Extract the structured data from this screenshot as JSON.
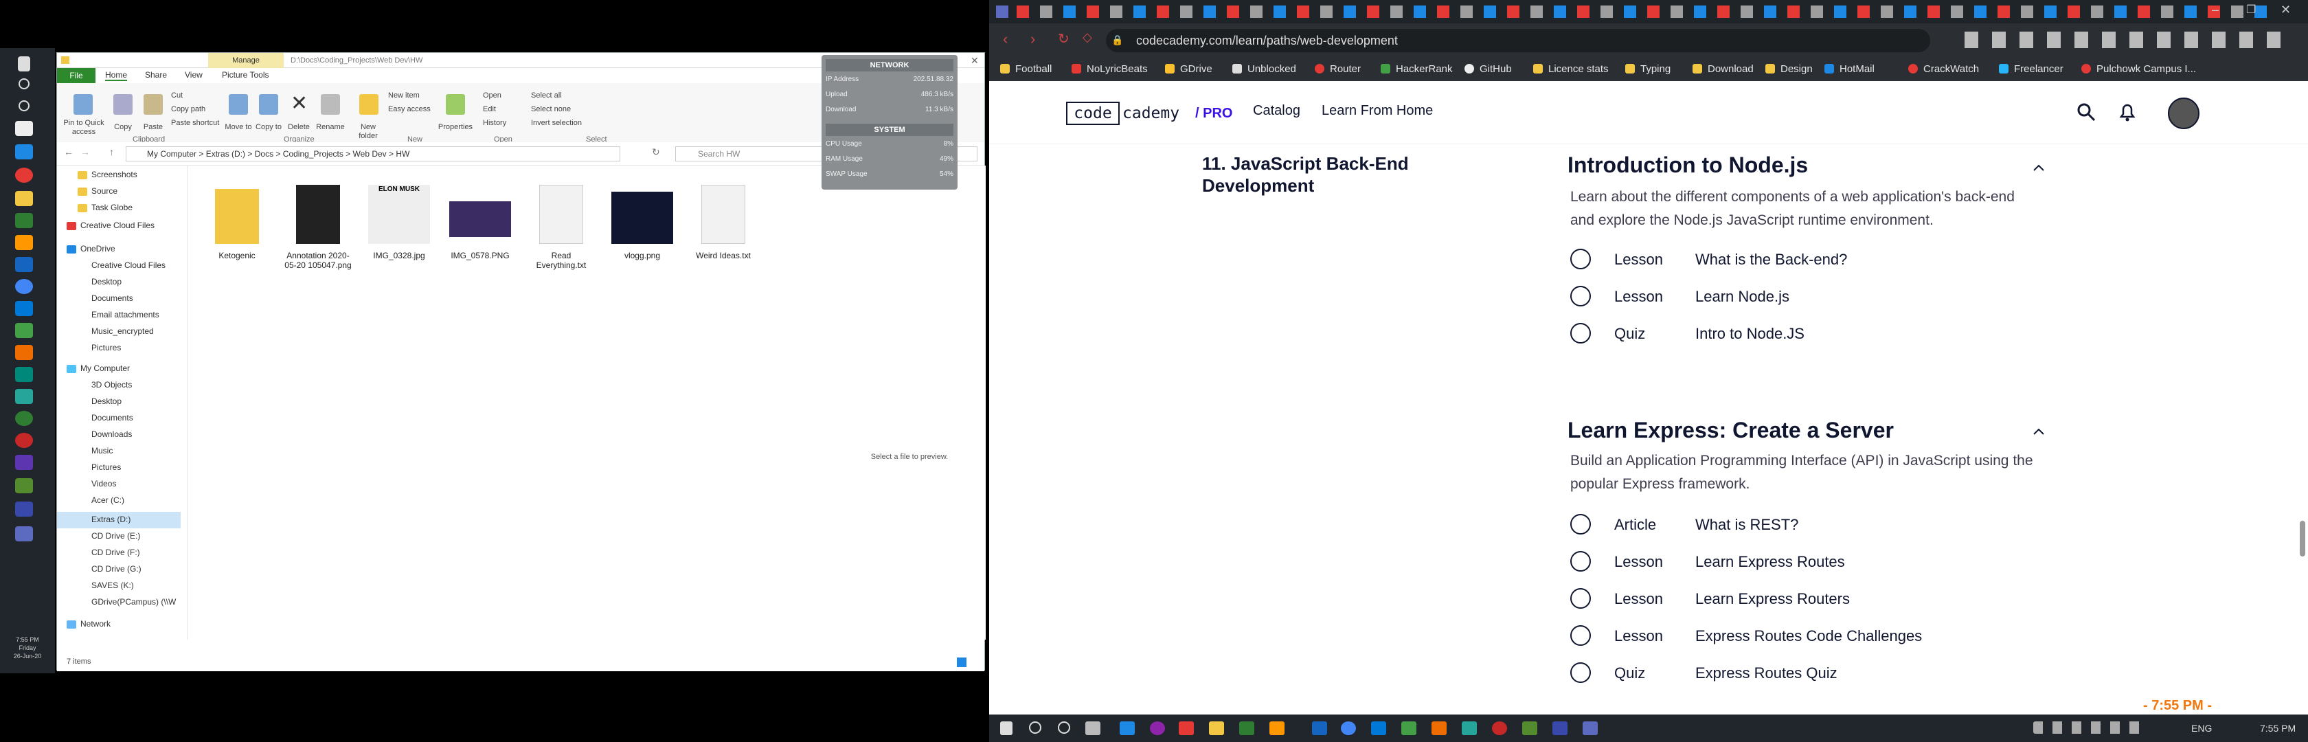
{
  "left_taskbar": {
    "time": "7:55 PM",
    "day": "Friday",
    "date": "26-Jun-20"
  },
  "explorer": {
    "manage_label": "Manage",
    "title_path": "D:\\Docs\\Coding_Projects\\Web Dev\\HW",
    "tabs": [
      "File",
      "Home",
      "Share",
      "View",
      "Picture Tools"
    ],
    "ribbon": {
      "pin": "Pin to Quick access",
      "copy": "Copy",
      "paste": "Paste",
      "cut": "Cut",
      "copy_path": "Copy path",
      "paste_shortcut": "Paste shortcut",
      "move_to": "Move to",
      "copy_to": "Copy to",
      "delete": "Delete",
      "rename": "Rename",
      "new_folder": "New folder",
      "new_item": "New item",
      "easy_access": "Easy access",
      "properties": "Properties",
      "open": "Open",
      "edit": "Edit",
      "history": "History",
      "select_all": "Select all",
      "select_none": "Select none",
      "invert": "Invert selection",
      "groups": [
        "Clipboard",
        "Organize",
        "New",
        "Open",
        "Select"
      ]
    },
    "address": [
      "My Computer",
      "Extras (D:)",
      "Docs",
      "Coding_Projects",
      "Web Dev",
      "HW"
    ],
    "search_placeholder": "Search HW",
    "nav": [
      "Screenshots",
      "Source",
      "Task Globe",
      "Creative Cloud Files",
      "OneDrive",
      "Creative Cloud Files",
      "Desktop",
      "Documents",
      "Email attachments",
      "Music_encrypted",
      "Pictures",
      "My Computer",
      "3D Objects",
      "Desktop",
      "Documents",
      "Downloads",
      "Music",
      "Pictures",
      "Videos",
      "Acer (C:)",
      "Extras (D:)",
      "CD Drive (E:)",
      "CD Drive (F:)",
      "CD Drive (G:)",
      "SAVES (K:)",
      "GDrive(PCampus) (\\\\W",
      "Network"
    ],
    "files": [
      "Ketogenic",
      "Annotation 2020-05-20 105047.png",
      "IMG_0328.jpg",
      "IMG_0578.PNG",
      "Read Everything.txt",
      "vlogg.png",
      "Weird Ideas.txt"
    ],
    "thumb_text": "ELON MUSK",
    "preview_text": "Select a file to preview.",
    "status": "7 items"
  },
  "gadget": {
    "network_title": "NETWORK",
    "ip_label": "IP Address",
    "ip": "202.51.88.32",
    "up_label": "Upload",
    "up": "486.3 kB/s",
    "down_label": "Download",
    "down": "11.3 kB/s",
    "system_title": "SYSTEM",
    "cpu_label": "CPU Usage",
    "cpu": "8%",
    "ram_label": "RAM Usage",
    "ram": "49%",
    "swap_label": "SWAP Usage",
    "swap": "54%"
  },
  "browser": {
    "url": "codecademy.com/learn/paths/web-development",
    "bookmarks": [
      "Football",
      "NoLyricBeats",
      "GDrive",
      "Unblocked",
      "Router",
      "HackerRank",
      "GitHub",
      "Licence stats",
      "Typing",
      "Download",
      "Design",
      "HotMail",
      "CrackWatch",
      "Freelancer",
      "Pulchowk Campus I..."
    ]
  },
  "codecademy": {
    "logo_code": "code",
    "logo_rest": "cademy",
    "logo_pro": "/ PRO",
    "nav": [
      "Catalog",
      "Learn From Home"
    ],
    "module_title": "11. JavaScript Back-End Development",
    "sections": [
      {
        "title": "Introduction to Node.js",
        "desc": "Learn about the different components of a web application's back-end and explore the Node.js JavaScript runtime environment.",
        "items": [
          {
            "type": "Lesson",
            "name": "What is the Back-end?"
          },
          {
            "type": "Lesson",
            "name": "Learn Node.js"
          },
          {
            "type": "Quiz",
            "name": "Intro to Node.JS"
          }
        ]
      },
      {
        "title": "Learn Express: Create a Server",
        "desc": "Build an Application Programming Interface (API) in JavaScript using the popular Express framework.",
        "items": [
          {
            "type": "Article",
            "name": "What is REST?"
          },
          {
            "type": "Lesson",
            "name": "Learn Express Routes"
          },
          {
            "type": "Lesson",
            "name": "Learn Express Routers"
          },
          {
            "type": "Lesson",
            "name": "Express Routes Code Challenges"
          },
          {
            "type": "Quiz",
            "name": "Express Routes Quiz"
          }
        ]
      }
    ]
  },
  "overlay_time": "- 7:55 PM -",
  "taskbar": {
    "lang": "ENG",
    "time": "7:55 PM"
  }
}
